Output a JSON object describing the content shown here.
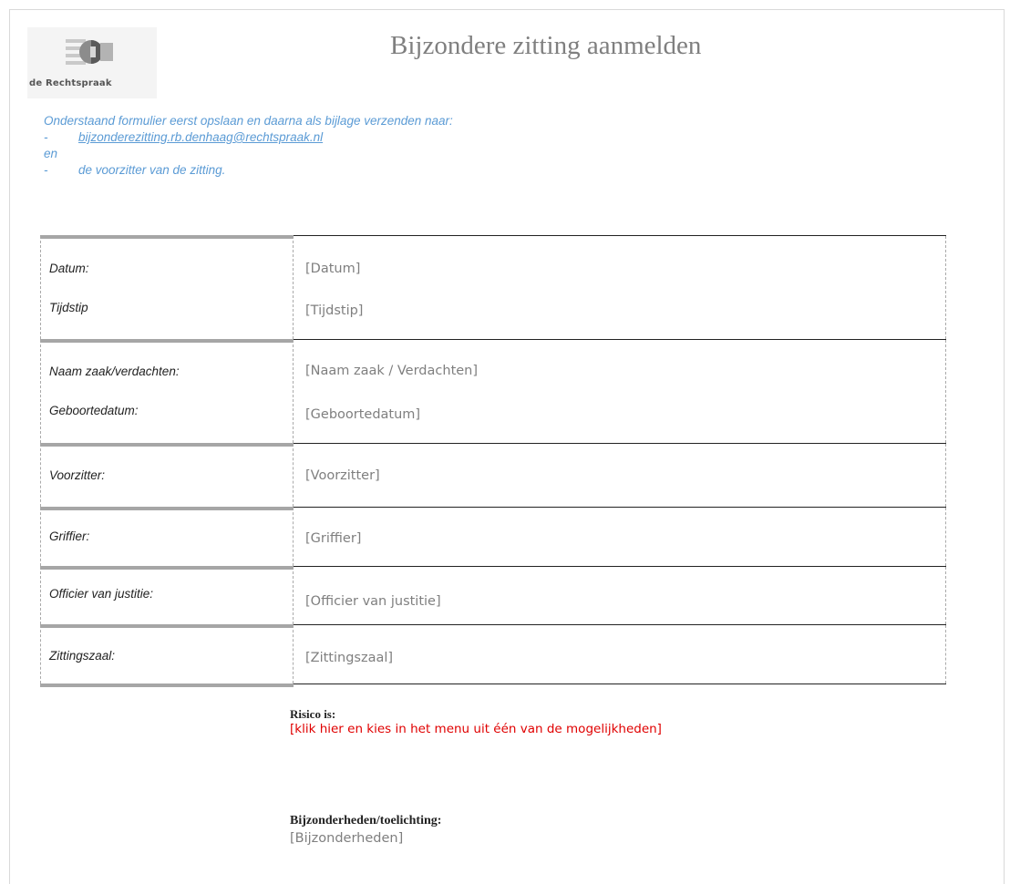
{
  "header": {
    "logo_text": "de Rechtspraak",
    "title": "Bijzondere zitting aanmelden"
  },
  "instructions": {
    "intro": "Onderstaand formulier eerst opslaan en daarna als bijlage verzenden naar:",
    "dash1": "-",
    "email": "bijzonderezitting.rb.denhaag@rechtspraak.nl",
    "conj": "en",
    "dash2": "-",
    "second": "de voorzitter van de zitting."
  },
  "form": {
    "rows": [
      {
        "label1": "Datum:",
        "value1": "[Datum]",
        "label2": "Tijdstip",
        "value2": "[Tijdstip]"
      },
      {
        "label1": "Naam zaak/verdachten:",
        "value1": "[Naam zaak / Verdachten]",
        "label2": "Geboortedatum:",
        "value2": "[Geboortedatum]"
      },
      {
        "label1": "Voorzitter:",
        "value1": "[Voorzitter]"
      },
      {
        "label1": "Griffier:",
        "value1": "[Griffier]"
      },
      {
        "label1": "Officier van justitie:",
        "value1": "[Officier van justitie]"
      },
      {
        "label1": "Zittingszaal:",
        "value1": "[Zittingszaal]"
      }
    ]
  },
  "risk": {
    "label": "Risico is:",
    "value": "[klik hier en kies in het menu uit één van de mogelijkheden]",
    "value_color": "#e00000"
  },
  "details": {
    "label": "Bijzonderheden/toelichting:",
    "value": "[Bijzonderheden]"
  },
  "colors": {
    "title": "#7f7f7f",
    "instructions": "#5b9bd5",
    "placeholder": "#7f7f7f"
  }
}
